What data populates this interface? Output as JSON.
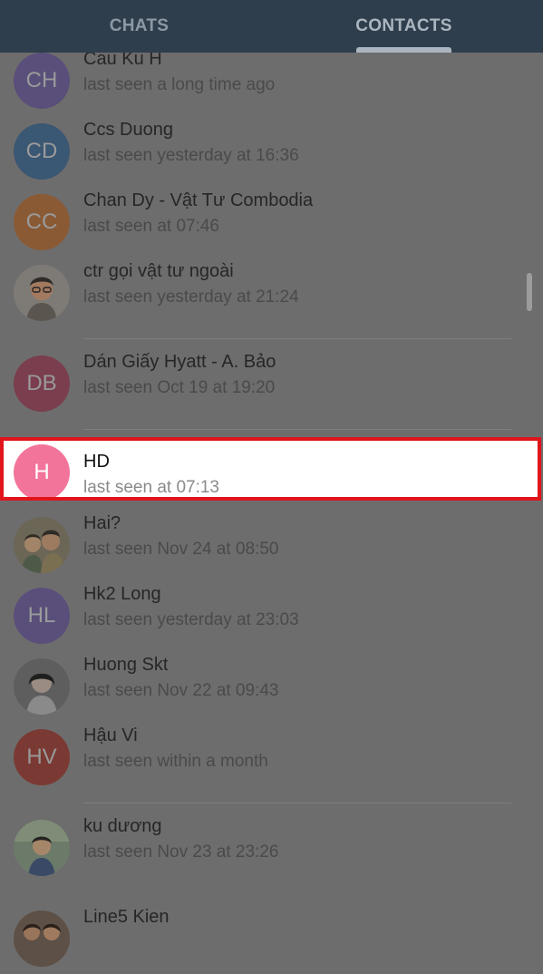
{
  "tabs": [
    {
      "label": "CHATS",
      "active": false
    },
    {
      "label": "CONTACTS",
      "active": true
    }
  ],
  "contacts": [
    {
      "name": "Cau Ku H",
      "status": "last seen a long time ago",
      "initials": "CH",
      "avatar_color": "#5a4f7a"
    },
    {
      "name": "Ccs Duong",
      "status": "last seen yesterday at 16:36",
      "initials": "CD",
      "avatar_color": "#3a5773"
    },
    {
      "name": "Chan Dy - Vật Tư Combodia",
      "status": "last seen at 07:46",
      "initials": "CC",
      "avatar_color": "#8a5a35"
    },
    {
      "name": "ctr gọi vật tư ngoài",
      "status": "last seen yesterday at 21:24",
      "avatar_icon": "photo-avatar-icon"
    },
    {
      "name": "Dán Giấy Hyatt - A. Bảo",
      "status": "last seen Oct 19 at 19:20",
      "initials": "DB",
      "avatar_color": "#7a3e4e"
    },
    {
      "name": "HD",
      "status": "last seen at 07:13",
      "initials": "H",
      "avatar_color": "#f3749a",
      "selected": true
    },
    {
      "name": "Hai?",
      "status": "last seen Nov 24 at 08:50",
      "avatar_icon": "photo-avatar-icon"
    },
    {
      "name": "Hk2 Long",
      "status": "last seen yesterday at 23:03",
      "initials": "HL",
      "avatar_color": "#5a4f7a"
    },
    {
      "name": "Huong Skt",
      "status": "last seen Nov 22 at 09:43",
      "avatar_icon": "photo-avatar-icon"
    },
    {
      "name": "Hậu Vi",
      "status": "last seen within a month",
      "initials": "HV",
      "avatar_color": "#7a3a33"
    },
    {
      "name": "ku dương",
      "status": "last seen Nov 23 at 23:26",
      "avatar_icon": "photo-avatar-icon"
    },
    {
      "name": "Line5 Kien",
      "status": "",
      "avatar_icon": "photo-avatar-icon"
    }
  ],
  "colors": {
    "tabbar": "#2f3e4d",
    "overlay_background": "#6e6d6d",
    "highlight_border": "#e1141c"
  }
}
